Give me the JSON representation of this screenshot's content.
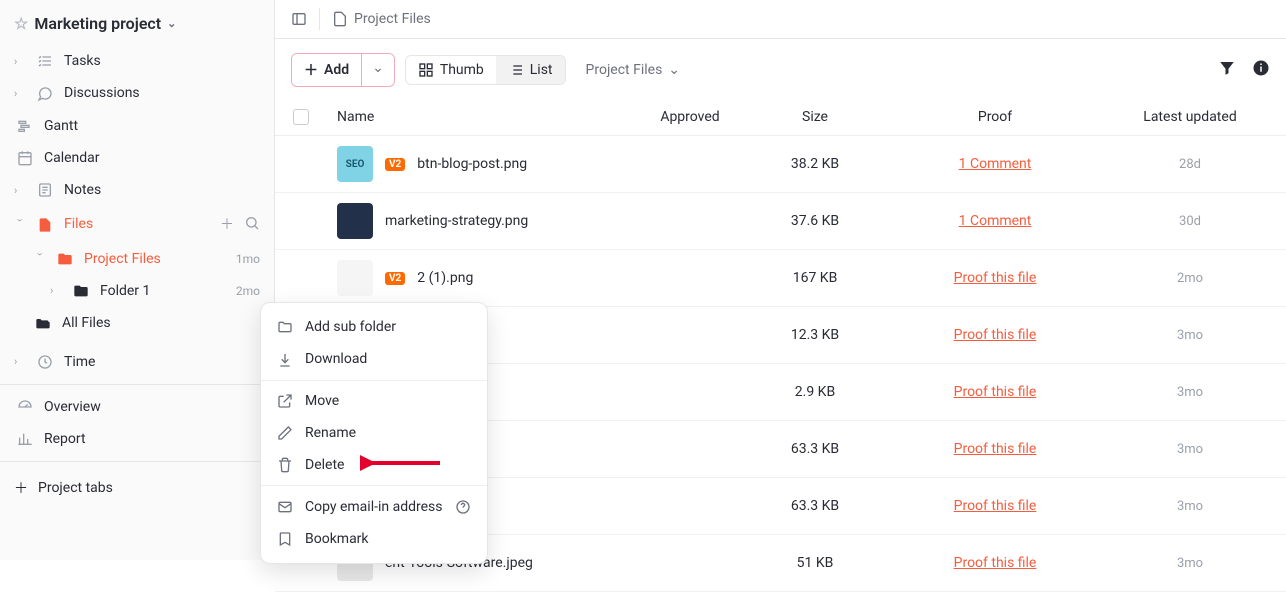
{
  "header": {
    "title": "Marketing project"
  },
  "sidebar": {
    "items": [
      {
        "label": "Tasks"
      },
      {
        "label": "Discussions"
      },
      {
        "label": "Gantt"
      },
      {
        "label": "Calendar"
      },
      {
        "label": "Notes"
      },
      {
        "label": "Files"
      },
      {
        "label": "Time"
      }
    ],
    "files_tree": {
      "project_files": {
        "label": "Project Files",
        "meta": "1mo"
      },
      "folder1": {
        "label": "Folder 1",
        "meta": "2mo"
      },
      "all_files": {
        "label": "All Files"
      }
    },
    "overview": "Overview",
    "report": "Report",
    "project_tabs": "Project tabs"
  },
  "topbar": {
    "breadcrumb": "Project Files"
  },
  "toolbar": {
    "add": "Add",
    "thumb": "Thumb",
    "list": "List",
    "select_label": "Project Files"
  },
  "columns": {
    "name": "Name",
    "approved": "Approved",
    "size": "Size",
    "proof": "Proof",
    "updated": "Latest updated"
  },
  "rows": [
    {
      "thumb_text": "SEO",
      "thumb_bg": "#7fd3e5",
      "badge": "V2",
      "name": "btn-blog-post.png",
      "size": "38.2 KB",
      "proof": "1 Comment",
      "updated": "28d"
    },
    {
      "thumb_text": "",
      "thumb_bg": "#22304a",
      "badge": "",
      "name": "marketing-strategy.png",
      "size": "37.6 KB",
      "proof": "1 Comment",
      "updated": "30d"
    },
    {
      "thumb_text": "",
      "thumb_bg": "#f5f5f5",
      "badge": "V2",
      "name": "2 (1).png",
      "size": "167 KB",
      "proof": "Proof this file",
      "updated": "2mo"
    },
    {
      "thumb_text": "",
      "thumb_bg": "#ff6a00",
      "badge": "",
      "name": "",
      "size": "12.3 KB",
      "proof": "Proof this file",
      "updated": "3mo"
    },
    {
      "thumb_text": "",
      "thumb_bg": "#e8e8e8",
      "badge": "",
      "name": "",
      "size": "2.9 KB",
      "proof": "Proof this file",
      "updated": "3mo"
    },
    {
      "thumb_text": "",
      "thumb_bg": "#e8e8e8",
      "badge": "",
      "name": "",
      "size": "63.3 KB",
      "proof": "Proof this file",
      "updated": "3mo"
    },
    {
      "thumb_text": "",
      "thumb_bg": "#e8e8e8",
      "badge": "",
      "name": "",
      "size": "63.3 KB",
      "proof": "Proof this file",
      "updated": "3mo"
    },
    {
      "thumb_text": "",
      "thumb_bg": "#e8e8e8",
      "badge": "",
      "name": "ent-Tools-Software.jpeg",
      "size": "51 KB",
      "proof": "Proof this file",
      "updated": "3mo"
    }
  ],
  "menu": {
    "add_sub": "Add sub folder",
    "download": "Download",
    "move": "Move",
    "rename": "Rename",
    "delete": "Delete",
    "copy": "Copy email-in address",
    "bookmark": "Bookmark"
  }
}
